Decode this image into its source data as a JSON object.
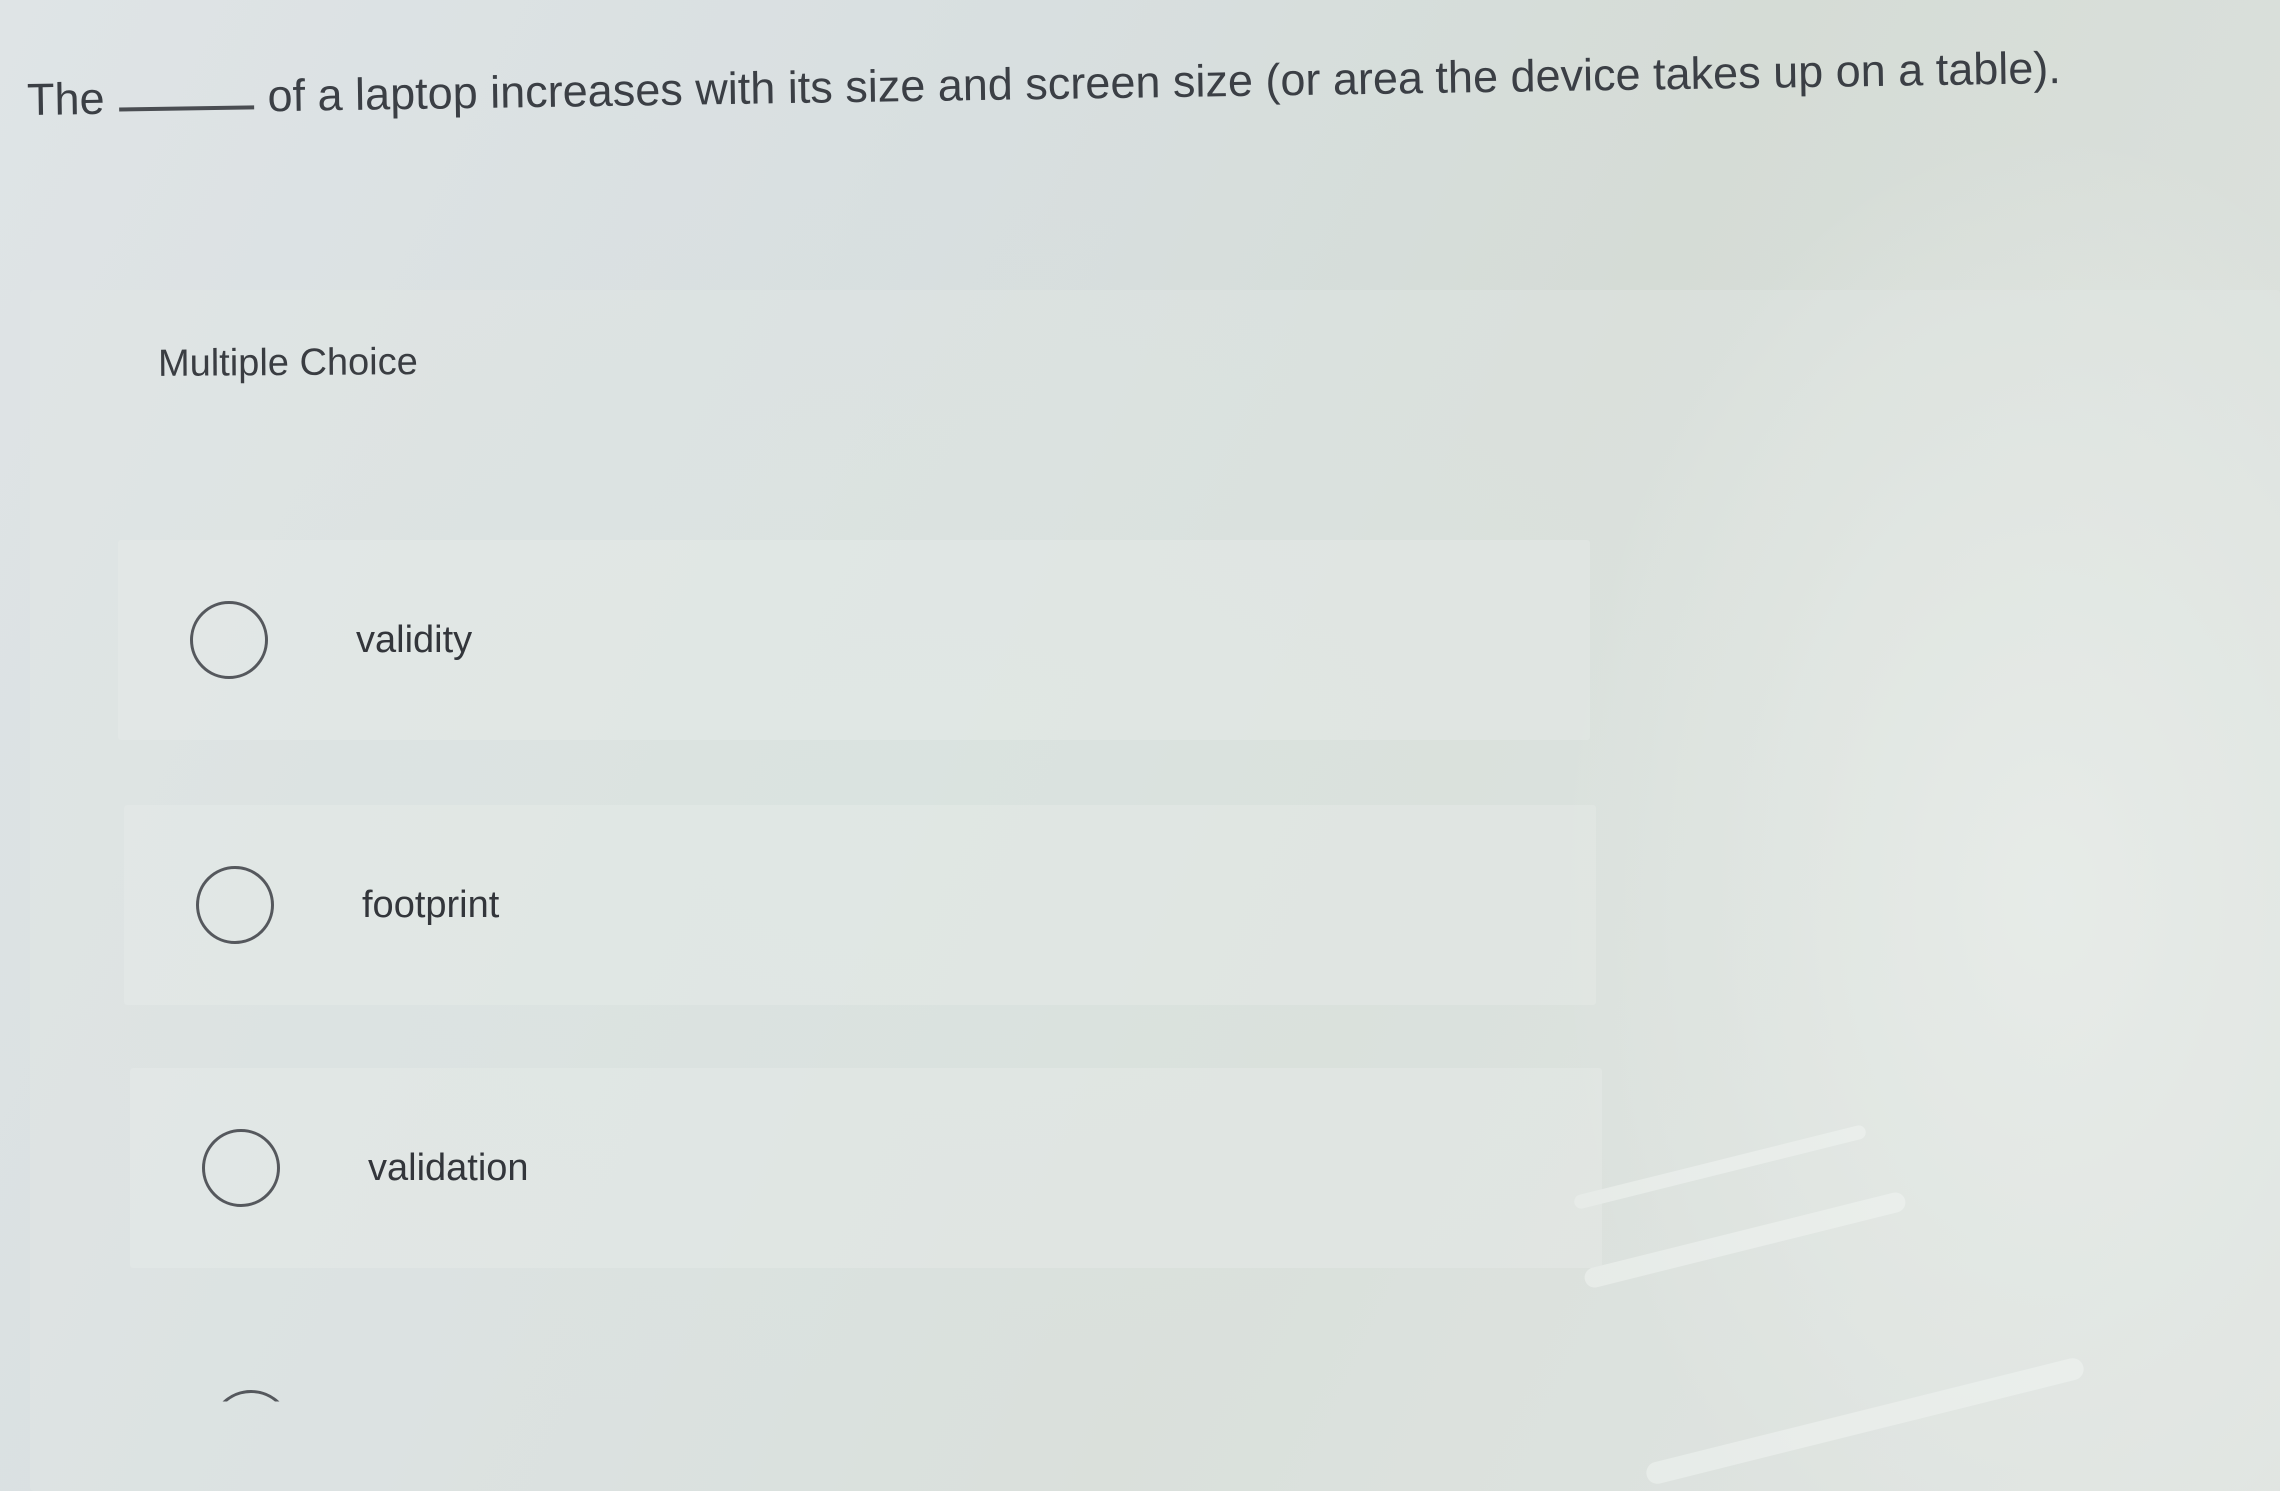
{
  "question": {
    "prefix": "The",
    "suffix": "of a laptop increases with its size and screen size (or area the device takes up on a table)."
  },
  "multiple_choice": {
    "title": "Multiple Choice",
    "options": [
      {
        "label": "validity"
      },
      {
        "label": "footprint"
      },
      {
        "label": "validation"
      }
    ]
  }
}
